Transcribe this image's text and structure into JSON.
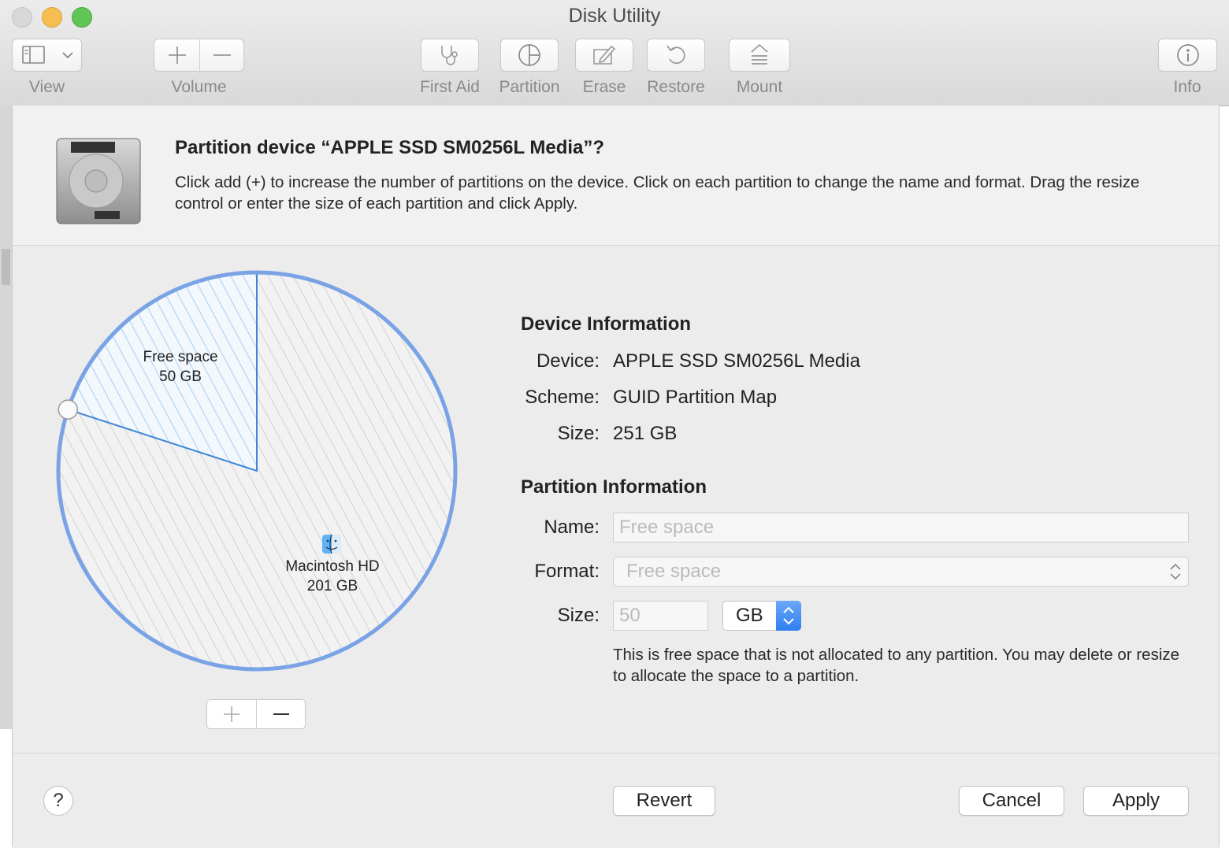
{
  "window": {
    "title": "Disk Utility"
  },
  "toolbar": {
    "view_label": "View",
    "volume_label": "Volume",
    "first_aid_label": "First Aid",
    "partition_label": "Partition",
    "erase_label": "Erase",
    "restore_label": "Restore",
    "mount_label": "Mount",
    "info_label": "Info"
  },
  "sheet": {
    "title": "Partition device “APPLE SSD SM0256L Media”?",
    "description": "Click add (+) to increase the number of partitions on the device. Click on each partition to change the name and format. Drag the resize control or enter the size of each partition and click Apply."
  },
  "pie": {
    "free_name": "Free space",
    "free_size": "50 GB",
    "main_name": "Macintosh HD",
    "main_size": "201 GB",
    "free_fraction": 0.2
  },
  "device_info": {
    "heading": "Device Information",
    "device_label": "Device:",
    "device_value": "APPLE SSD SM0256L Media",
    "scheme_label": "Scheme:",
    "scheme_value": "GUID Partition Map",
    "size_label": "Size:",
    "size_value": "251 GB"
  },
  "partition_info": {
    "heading": "Partition Information",
    "name_label": "Name:",
    "name_placeholder": "Free space",
    "format_label": "Format:",
    "format_value": "Free space",
    "size_label": "Size:",
    "size_value": "50",
    "unit_value": "GB",
    "note": "This is free space that is not allocated to any partition. You may delete or resize to allocate the space to a partition."
  },
  "buttons": {
    "help": "?",
    "revert": "Revert",
    "cancel": "Cancel",
    "apply": "Apply"
  },
  "colors": {
    "accent": "#3b82f6",
    "pie_outline": "#7aa3e6",
    "free_hatch": "#8fc0ee"
  }
}
